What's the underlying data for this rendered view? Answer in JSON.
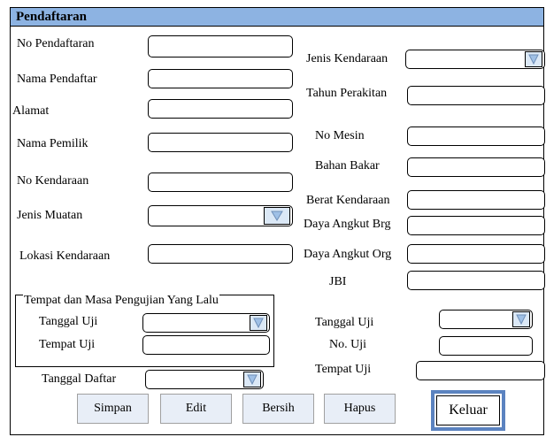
{
  "form": {
    "title": "Pendaftaran"
  },
  "left": {
    "no_pendaftaran": "No Pendaftaran",
    "nama_pendaftar": "Nama Pendaftar",
    "alamat": "Alamat",
    "nama_pemilik": "Nama Pemilik",
    "no_kendaraan": "No Kendaraan",
    "jenis_muatan": "Jenis Muatan",
    "lokasi_kendaraan": "Lokasi Kendaraan"
  },
  "right": {
    "jenis_kendaraan": "Jenis Kendaraan",
    "tahun_perakitan": "Tahun Perakitan",
    "no_mesin": "No Mesin",
    "bahan_bakar": "Bahan Bakar",
    "berat_kendaraan": "Berat Kendaraan",
    "daya_angkut_brg": "Daya Angkut Brg",
    "daya_angkut_org": "Daya Angkut Org",
    "jbi": "JBI",
    "tanggal_uji": "Tanggal Uji",
    "no_uji": "No. Uji",
    "tempat_uji": "Tempat Uji"
  },
  "previous_test": {
    "group_title": "Tempat dan Masa Pengujian Yang Lalu",
    "tanggal_uji": "Tanggal Uji",
    "tempat_uji": "Tempat Uji"
  },
  "tanggal_daftar": "Tanggal Daftar",
  "buttons": {
    "simpan": "Simpan",
    "edit": "Edit",
    "bersih": "Bersih",
    "hapus": "Hapus",
    "keluar": "Keluar"
  },
  "colors": {
    "titlebar": "#8db3e2",
    "button_bg": "#e8eef7",
    "default_button_border": "#5b83c0"
  }
}
